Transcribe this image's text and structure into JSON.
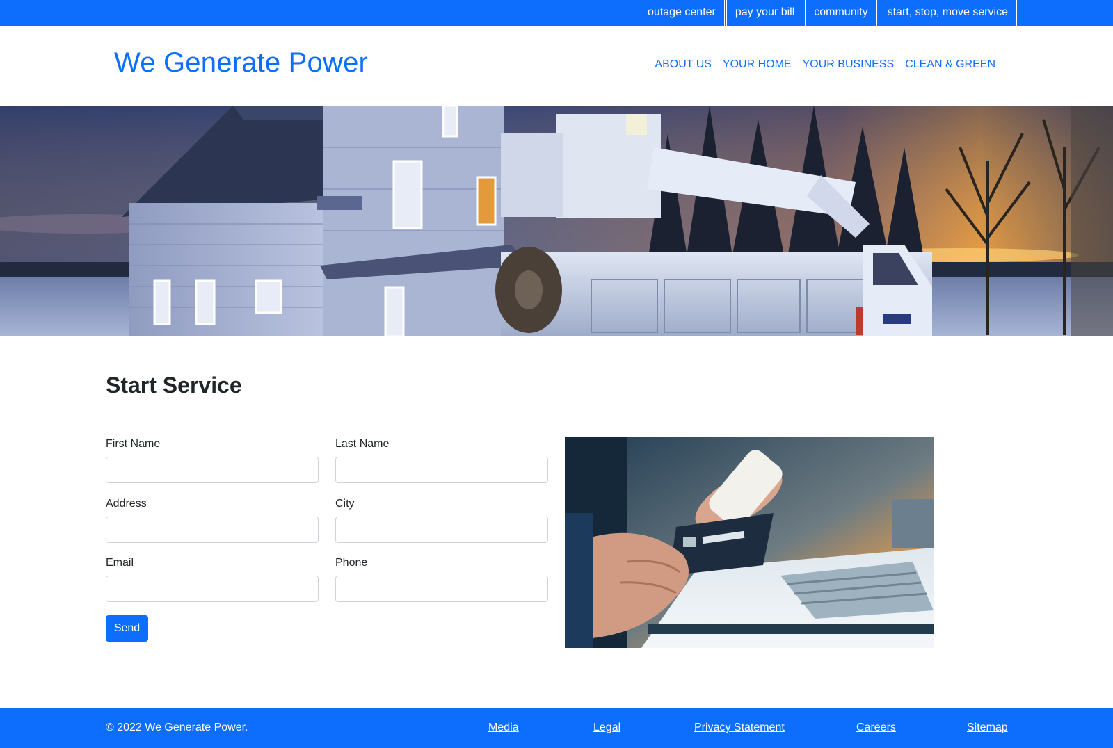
{
  "utility_nav": [
    "outage center",
    "pay your bill",
    "community",
    "start, stop, move service"
  ],
  "brand": "We Generate Power",
  "main_nav": [
    "ABOUT US",
    "YOUR HOME",
    "YOUR BUSINESS",
    "CLEAN & GREEN"
  ],
  "page_title": "Start Service",
  "form": {
    "first_name_label": "First Name",
    "last_name_label": "Last Name",
    "address_label": "Address",
    "city_label": "City",
    "email_label": "Email",
    "phone_label": "Phone",
    "first_name_value": "",
    "last_name_value": "",
    "address_value": "",
    "city_value": "",
    "email_value": "",
    "phone_value": "",
    "send_label": "Send"
  },
  "footer": {
    "copyright": "© 2022 We Generate Power.",
    "links": [
      "Media",
      "Legal",
      "Privacy Statement",
      "Careers",
      "Sitemap"
    ]
  },
  "colors": {
    "brand_blue": "#0d6efd",
    "text": "#212529",
    "input_border": "#ced4da"
  }
}
